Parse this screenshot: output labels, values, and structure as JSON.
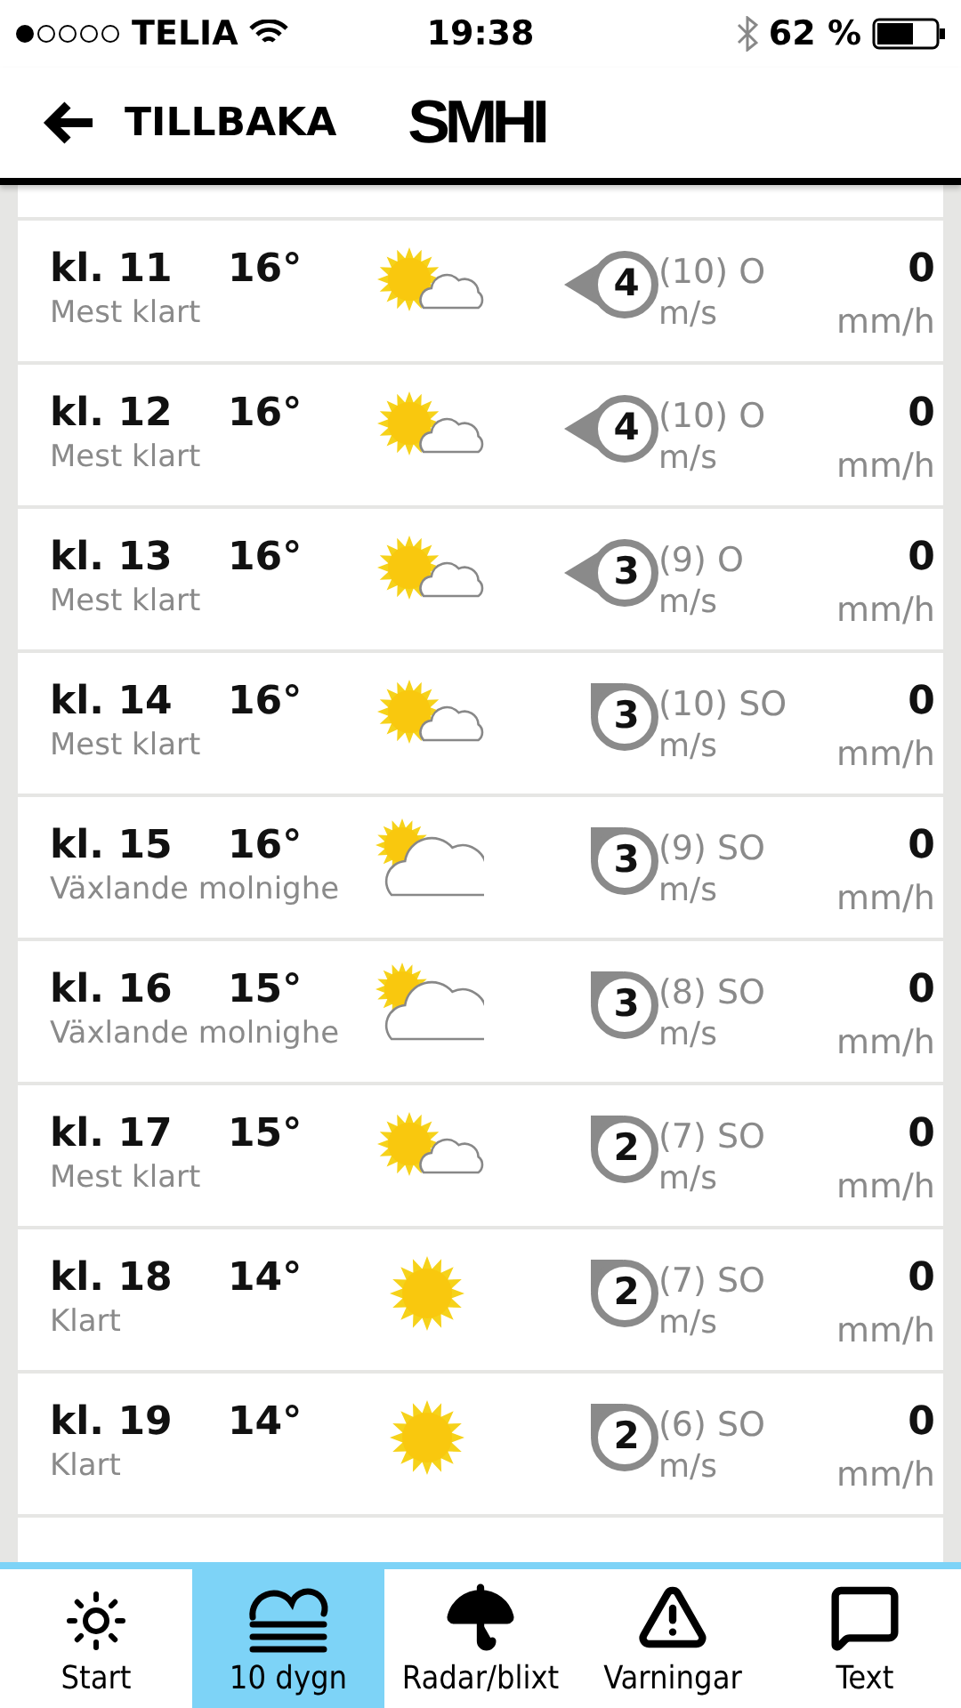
{
  "status_bar": {
    "carrier": "TELIA",
    "time": "19:38",
    "battery": "62 %"
  },
  "header": {
    "back": "TILLBAKA",
    "logo": "SMHI"
  },
  "rows": [
    {
      "time": "kl. 11",
      "temp": "16°",
      "desc": "Mest klart",
      "kind": "sun-cloud",
      "wind": {
        "kind": "east",
        "speed": "4"
      },
      "gust": "(10)",
      "direction": "O",
      "wind_unit": "m/s",
      "precip": "0",
      "precip_unit": "mm/h"
    },
    {
      "time": "kl. 12",
      "temp": "16°",
      "desc": "Mest klart",
      "kind": "sun-cloud",
      "wind": {
        "kind": "east",
        "speed": "4"
      },
      "gust": "(10)",
      "direction": "O",
      "wind_unit": "m/s",
      "precip": "0",
      "precip_unit": "mm/h"
    },
    {
      "time": "kl. 13",
      "temp": "16°",
      "desc": "Mest klart",
      "kind": "sun-cloud",
      "wind": {
        "kind": "east",
        "speed": "3"
      },
      "gust": "(9)",
      "direction": "O",
      "wind_unit": "m/s",
      "precip": "0",
      "precip_unit": "mm/h"
    },
    {
      "time": "kl. 14",
      "temp": "16°",
      "desc": "Mest klart",
      "kind": "sun-cloud",
      "wind": {
        "kind": "southeast",
        "speed": "3"
      },
      "gust": "(10)",
      "direction": "SO",
      "wind_unit": "m/s",
      "precip": "0",
      "precip_unit": "mm/h"
    },
    {
      "time": "kl. 15",
      "temp": "16°",
      "desc": "Växlande molnighe",
      "kind": "cloud-sun",
      "wind": {
        "kind": "southeast",
        "speed": "3"
      },
      "gust": "(9)",
      "direction": "SO",
      "wind_unit": "m/s",
      "precip": "0",
      "precip_unit": "mm/h"
    },
    {
      "time": "kl. 16",
      "temp": "15°",
      "desc": "Växlande molnighe",
      "kind": "cloud-sun",
      "wind": {
        "kind": "southeast",
        "speed": "3"
      },
      "gust": "(8)",
      "direction": "SO",
      "wind_unit": "m/s",
      "precip": "0",
      "precip_unit": "mm/h"
    },
    {
      "time": "kl. 17",
      "temp": "15°",
      "desc": "Mest klart",
      "kind": "sun-cloud",
      "wind": {
        "kind": "southeast",
        "speed": "2"
      },
      "gust": "(7)",
      "direction": "SO",
      "wind_unit": "m/s",
      "precip": "0",
      "precip_unit": "mm/h"
    },
    {
      "time": "kl. 18",
      "temp": "14°",
      "desc": "Klart",
      "kind": "sun",
      "wind": {
        "kind": "southeast",
        "speed": "2"
      },
      "gust": "(7)",
      "direction": "SO",
      "wind_unit": "m/s",
      "precip": "0",
      "precip_unit": "mm/h"
    },
    {
      "time": "kl. 19",
      "temp": "14°",
      "desc": "Klart",
      "kind": "sun",
      "wind": {
        "kind": "southeast",
        "speed": "2"
      },
      "gust": "(6)",
      "direction": "SO",
      "wind_unit": "m/s",
      "precip": "0",
      "precip_unit": "mm/h"
    }
  ],
  "tabs": [
    {
      "label": "Start",
      "kind": "sun",
      "selected": false
    },
    {
      "label": "10 dygn",
      "kind": "cloud",
      "selected": true
    },
    {
      "label": "Radar/blixt",
      "kind": "umbrella",
      "selected": false
    },
    {
      "label": "Varningar",
      "kind": "warning",
      "selected": false
    },
    {
      "label": "Text",
      "kind": "text",
      "selected": false
    }
  ]
}
